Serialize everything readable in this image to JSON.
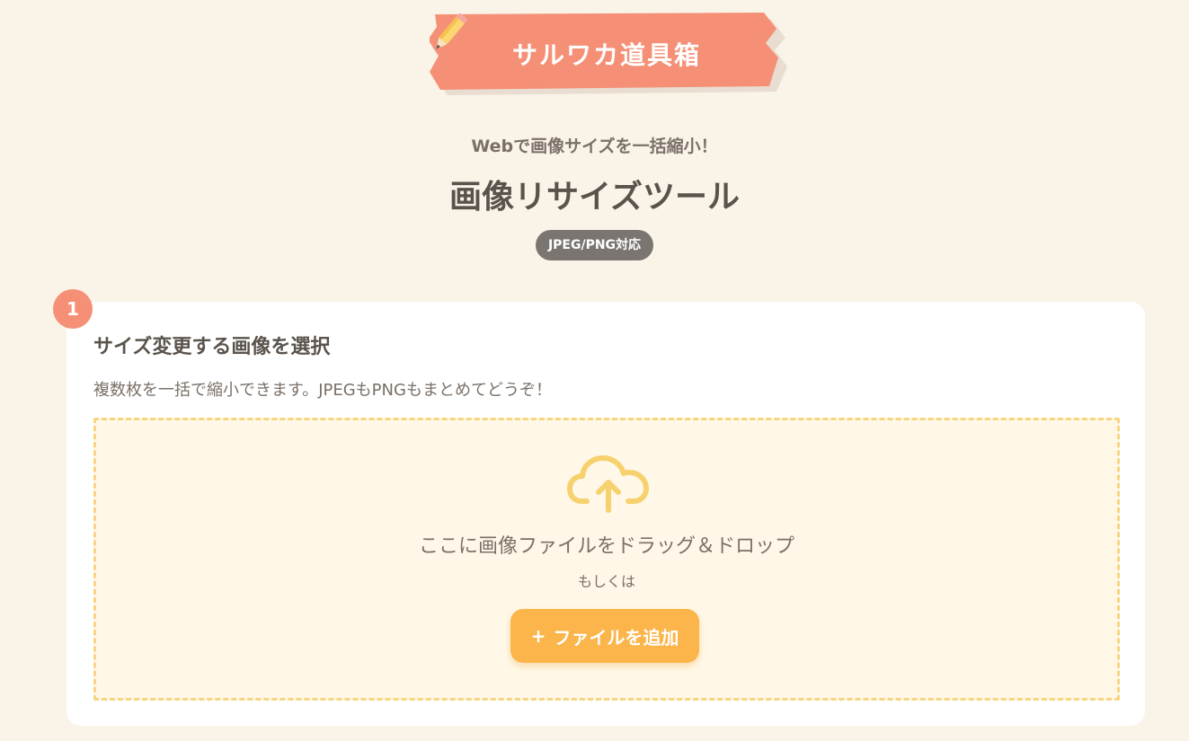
{
  "logo": {
    "text": "サルワカ道具箱",
    "icon": "pencil-icon",
    "banner_color": "#f59077"
  },
  "header": {
    "subtitle": "Webで画像サイズを一括縮小！",
    "title": "画像リサイズツール",
    "badge": "JPEG/PNG対応"
  },
  "step1": {
    "number": "1",
    "title": "サイズ変更する画像を選択",
    "description": "複数枚を一括で縮小できます。JPEGもPNGもまとめてどうぞ！",
    "dropzone": {
      "icon": "cloud-upload-icon",
      "text": "ここに画像ファイルをドラッグ＆ドロップ",
      "or": "もしくは",
      "button_icon": "+",
      "button_label": "ファイルを追加"
    }
  },
  "colors": {
    "background": "#faf3e8",
    "accent": "#f59077",
    "button": "#fbb54a",
    "dropzone_border": "#f8d67f"
  }
}
